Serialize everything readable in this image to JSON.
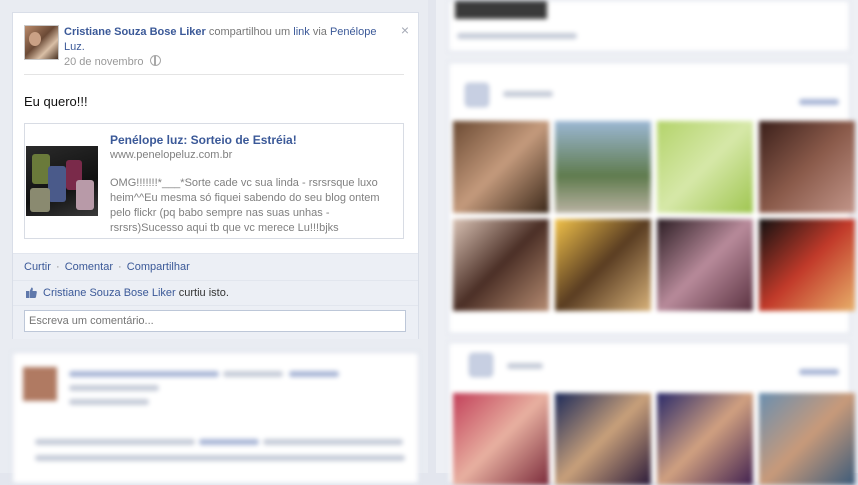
{
  "story": {
    "author": "Cristiane Souza Bose Liker",
    "action_text": " compartilhou um ",
    "link_word": "link",
    "via_text": " via ",
    "via_page": "Penélope Luz.",
    "date": "20 de novembro",
    "message": "Eu quero!!!",
    "attachment": {
      "title": "Penélope luz: Sorteio de Estréia!",
      "url": "www.penelopeluz.com.br",
      "description": "OMG!!!!!!!*___*Sorte cade vc sua linda - rsrsrsque luxo heim^^Eu mesma só fiquei sabendo do seu blog ontem pelo flickr (pq babo sempre nas suas unhas - rsrsrs)Sucesso aqui tb que vc merece Lu!!!bjks"
    },
    "actions": {
      "like": "Curtir",
      "comment": "Comentar",
      "share": "Compartilhar",
      "separator": "·"
    },
    "likes": {
      "name": "Cristiane Souza Bose Liker",
      "suffix": " curtiu isto."
    },
    "comment_placeholder": "Escreva um comentário...",
    "close_glyph": "×"
  },
  "colors": {
    "link": "#3b5998",
    "action_bar": "#eceff5",
    "page_background": "#e3e6ee"
  }
}
